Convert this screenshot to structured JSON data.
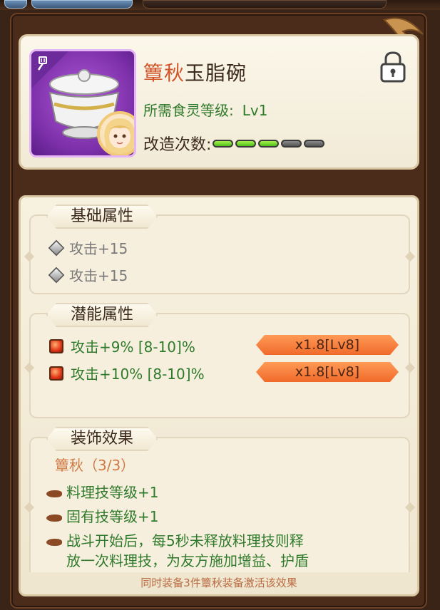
{
  "item": {
    "set_name": "簟秋",
    "item_name": "玉脂碗",
    "required_level_label": "所需食灵等级:",
    "required_level_value": "Lv1",
    "refine_label": "改造次数:",
    "refine_filled": 3,
    "refine_total": 5
  },
  "icons": {
    "type_icon": "spatula-icon",
    "lock_icon": "lock-icon",
    "stat_gem_grey": "grey-gem-icon",
    "stat_gem_red": "red-gem-icon",
    "bullet": "fish-bullet-icon"
  },
  "base_attributes": {
    "heading": "基础属性",
    "stats": [
      "攻击+15",
      "攻击+15"
    ]
  },
  "potential_attributes": {
    "heading": "潜能属性",
    "stats": [
      {
        "text": "攻击+9% [8-10]%",
        "badge": "x1.8[Lv8]"
      },
      {
        "text": "攻击+10% [8-10]%",
        "badge": "x1.8[Lv8]"
      }
    ]
  },
  "decoration_effect": {
    "heading": "装饰效果",
    "set_label": "簟秋（3/3）",
    "bonuses": [
      "料理技等级+1",
      "固有技等级+1",
      "战斗开始后，每5秒未释放料理技则释",
      "放一次料理技，为友方施加增益、护盾"
    ],
    "footnote": "同时装备3件簟秋装备激活该效果"
  },
  "colors": {
    "set_name": "#d2552a",
    "green_text": "#2f7a2b",
    "grey_text": "#7a7a7a",
    "badge": "#f06a2a",
    "icon_bg": "#7a2ea8"
  }
}
